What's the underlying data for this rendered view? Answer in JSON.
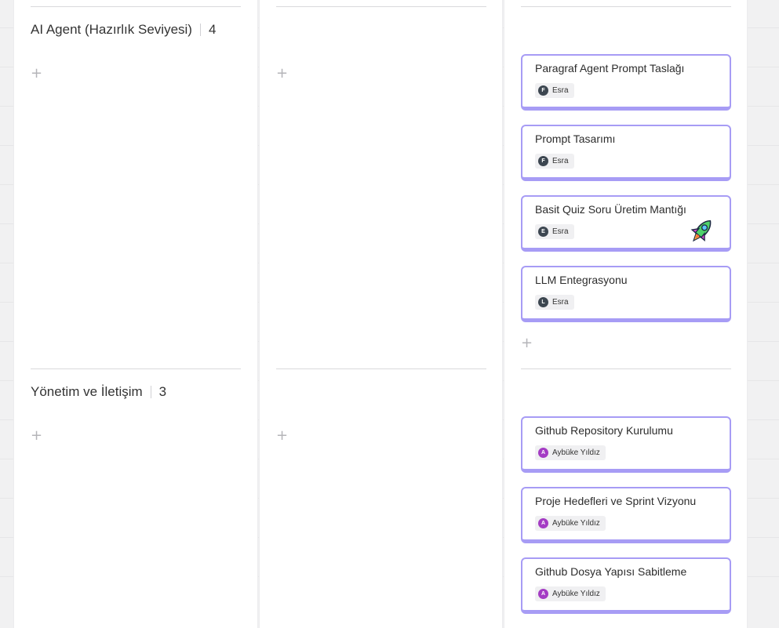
{
  "colors": {
    "card_border": "#a79cf5",
    "avatar_dark": "#3c4650",
    "avatar_purple": "#a43cc4"
  },
  "groups": [
    {
      "title": "AI Agent (Hazırlık Seviyesi)",
      "count": "4",
      "add_symbol": "+",
      "cards": [
        {
          "title": "Paragraf Agent Prompt Taslağı",
          "assignee": "Esra",
          "avatar_initial": "F"
        },
        {
          "title": "Prompt Tasarımı",
          "assignee": "Esra",
          "avatar_initial": "F"
        },
        {
          "title": "Basit Quiz Soru Üretim Mantığı",
          "assignee": "Esra",
          "avatar_initial": "E",
          "sticker": "rocket-icon"
        },
        {
          "title": "LLM Entegrasyonu",
          "assignee": "Esra",
          "avatar_initial": "L"
        }
      ]
    },
    {
      "title": "Yönetim ve İletişim",
      "count": "3",
      "add_symbol": "+",
      "cards": [
        {
          "title": "Github Repository Kurulumu",
          "assignee": "Aybüke Yıldız",
          "avatar_initial": "A"
        },
        {
          "title": "Proje Hedefleri ve Sprint Vizyonu",
          "assignee": "Aybüke Yıldız",
          "avatar_initial": "A"
        },
        {
          "title": "Github Dosya Yapısı Sabitleme",
          "assignee": "Aybüke Yıldız",
          "avatar_initial": "A"
        }
      ]
    }
  ]
}
